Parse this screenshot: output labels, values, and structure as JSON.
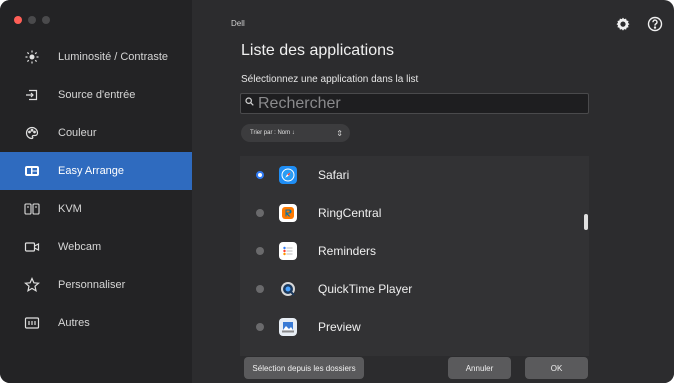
{
  "window": {
    "brand": "Dell"
  },
  "sidebar": {
    "items": [
      {
        "label": "Luminosité / Contraste",
        "icon": "brightness-icon"
      },
      {
        "label": "Source d'entrée",
        "icon": "input-source-icon"
      },
      {
        "label": "Couleur",
        "icon": "color-palette-icon"
      },
      {
        "label": "Easy Arrange",
        "icon": "easy-arrange-icon",
        "active": true
      },
      {
        "label": "KVM",
        "icon": "kvm-icon"
      },
      {
        "label": "Webcam",
        "icon": "webcam-icon"
      },
      {
        "label": "Personnaliser",
        "icon": "star-icon"
      },
      {
        "label": "Autres",
        "icon": "others-icon"
      }
    ]
  },
  "main": {
    "title": "Liste des applications",
    "subtitle": "Sélectionnez une application dans la list",
    "search": {
      "placeholder": "Rechercher",
      "value": ""
    },
    "sort": {
      "label": "Trier par : Nom ↓"
    },
    "apps": [
      {
        "name": "Safari",
        "icon": "safari-icon",
        "selected": true
      },
      {
        "name": "RingCentral",
        "icon": "ringcentral-icon",
        "selected": false
      },
      {
        "name": "Reminders",
        "icon": "reminders-icon",
        "selected": false
      },
      {
        "name": "QuickTime Player",
        "icon": "quicktime-icon",
        "selected": false
      },
      {
        "name": "Preview",
        "icon": "preview-icon",
        "selected": false
      }
    ]
  },
  "buttons": {
    "folders": "Sélection depuis les dossiers",
    "cancel": "Annuler",
    "ok": "OK"
  },
  "colors": {
    "accent": "#2f6bbf",
    "background": "#2c2c2e",
    "sidebar": "#232325"
  }
}
